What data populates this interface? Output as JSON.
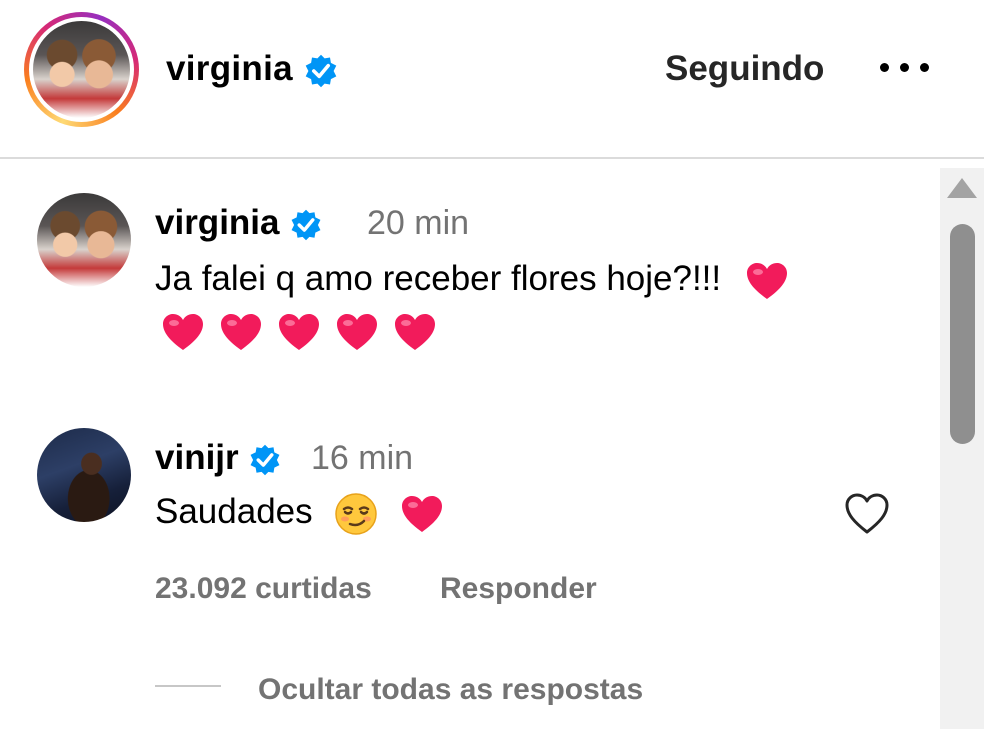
{
  "header": {
    "username": "virginia",
    "follow_label": "Seguindo",
    "verified_icon": "verified-badge-icon",
    "more_icon": "more-options-icon"
  },
  "comments": [
    {
      "username": "virginia",
      "time": "20 min",
      "text": "Ja falei q amo receber flores hoje?!!!",
      "emoji_hearts": 6
    },
    {
      "username": "vinijr",
      "time": "16 min",
      "text": "Saudades",
      "emojis": [
        "smirk-face",
        "heart"
      ],
      "likes": "23.092 curtidas",
      "reply_label": "Responder"
    }
  ],
  "hide_replies_label": "Ocultar todas as respostas",
  "colors": {
    "verified": "#0095f6",
    "heart": "#f21b5b",
    "secondary_text": "#737373"
  }
}
